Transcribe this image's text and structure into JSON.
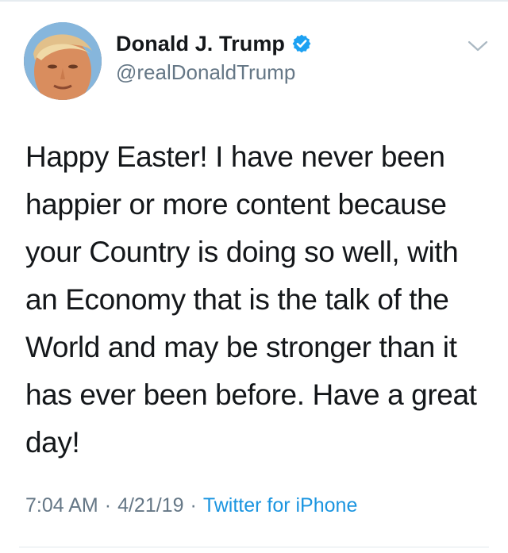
{
  "tweet": {
    "author": {
      "display_name": "Donald J. Trump",
      "handle": "@realDonaldTrump",
      "verified": true,
      "avatar": "profile-photo"
    },
    "text": "Happy Easter! I have never been happier or more content because your Country is doing so well, with an Economy that is the talk of the World and may be stronger than it has ever been before. Have a great day!",
    "time": "7:04 AM",
    "separator": "·",
    "date": "4/21/19",
    "source": "Twitter for iPhone"
  },
  "icons": {
    "verified": "verified-badge-icon",
    "menu": "chevron-down-icon"
  },
  "colors": {
    "text": "#14171a",
    "secondary": "#657786",
    "link": "#1b95e0",
    "verified": "#1da1f2",
    "divider": "#e1e8ed"
  }
}
